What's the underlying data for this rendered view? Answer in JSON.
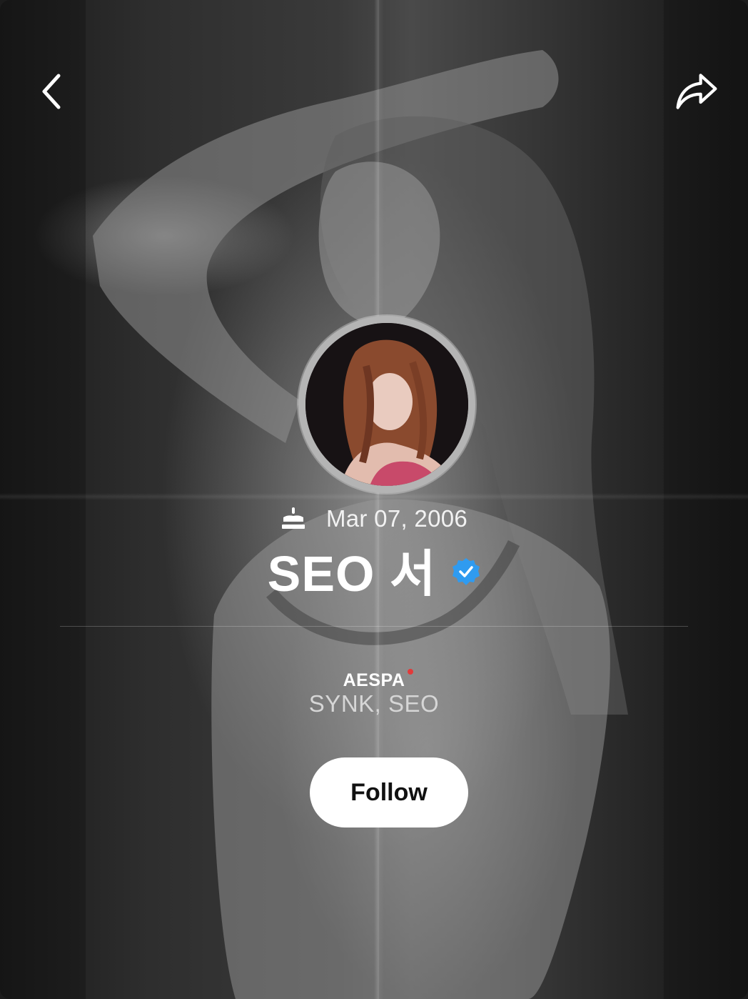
{
  "header": {
    "back_icon": "chevron-left-icon",
    "share_icon": "share-arrow-icon"
  },
  "profile": {
    "birthday_icon": "cake-icon",
    "birthday": "Mar 07, 2006",
    "name": "SEO 서",
    "verified_icon": "verified-badge-icon",
    "verified_color": "#2f9bf0",
    "group": "AESPA",
    "group_accent_color": "#e23a3a",
    "members": "SYNK, SEO"
  },
  "actions": {
    "follow_label": "Follow"
  }
}
